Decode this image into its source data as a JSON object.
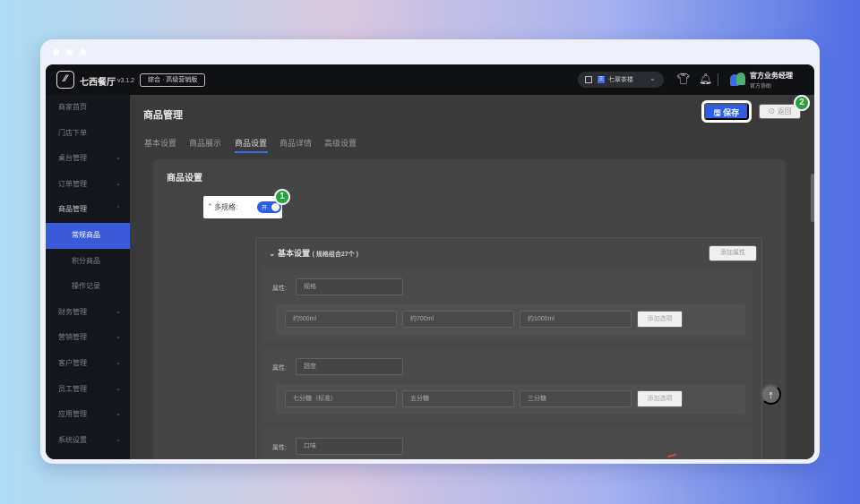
{
  "app": {
    "brand": "七西餐厅",
    "version": "v3.1.2",
    "plan_tag": "综合 · 高级营销版",
    "store": {
      "badge": "王",
      "name": "七翠茶楼"
    },
    "user": {
      "name": "官方业务经理",
      "role": "官方协助"
    }
  },
  "sidebar": {
    "items": [
      {
        "label": "商家首页",
        "arrow": ""
      },
      {
        "label": "门店下单",
        "arrow": ""
      },
      {
        "label": "桌台管理",
        "arrow": "⌄"
      },
      {
        "label": "订单管理",
        "arrow": "⌄"
      },
      {
        "label": "商品管理",
        "arrow": "⌃"
      },
      {
        "label": "常规商品",
        "arrow": ""
      },
      {
        "label": "积分商品",
        "arrow": ""
      },
      {
        "label": "操作记录",
        "arrow": ""
      },
      {
        "label": "财务管理",
        "arrow": "⌄"
      },
      {
        "label": "营销管理",
        "arrow": "⌄"
      },
      {
        "label": "客户管理",
        "arrow": "⌄"
      },
      {
        "label": "员工管理",
        "arrow": "⌄"
      },
      {
        "label": "应用管理",
        "arrow": "⌄"
      },
      {
        "label": "系统设置",
        "arrow": "⌄"
      }
    ]
  },
  "main": {
    "title": "商品管理",
    "tabs": [
      "基本设置",
      "商品展示",
      "商品设置",
      "商品详情",
      "高级设置"
    ],
    "save_label": "保存",
    "back_label": "返回",
    "steps": [
      "1",
      "2"
    ]
  },
  "card": {
    "title": "商品设置",
    "multi_spec_label": "多规格:",
    "required_mark": "*",
    "toggle_text": "开"
  },
  "spec": {
    "header": "基本设置",
    "header_sub": "( 规格组合27个 )",
    "add_attr_label": "添加属性",
    "attr_label": "属性:",
    "add_option_label": "添加选项",
    "attributes": [
      {
        "name": "规格",
        "options": [
          "约500ml",
          "约700ml",
          "约1000ml"
        ]
      },
      {
        "name": "甜度",
        "options": [
          "七分糖（标准）",
          "五分糖",
          "三分糖"
        ]
      },
      {
        "name": "口味",
        "options": []
      }
    ]
  },
  "icons": {
    "logo": "logo-icon",
    "save": "save-icon",
    "back": "back-icon",
    "shirt": "shirt-icon",
    "bell": "bell-icon",
    "scroll_top": "arrow-up-icon"
  },
  "colors": {
    "accent": "#2d5ee8",
    "step": "#27a33d",
    "sidebar_active": "#3a5bd9",
    "required": "#e03c3c"
  }
}
